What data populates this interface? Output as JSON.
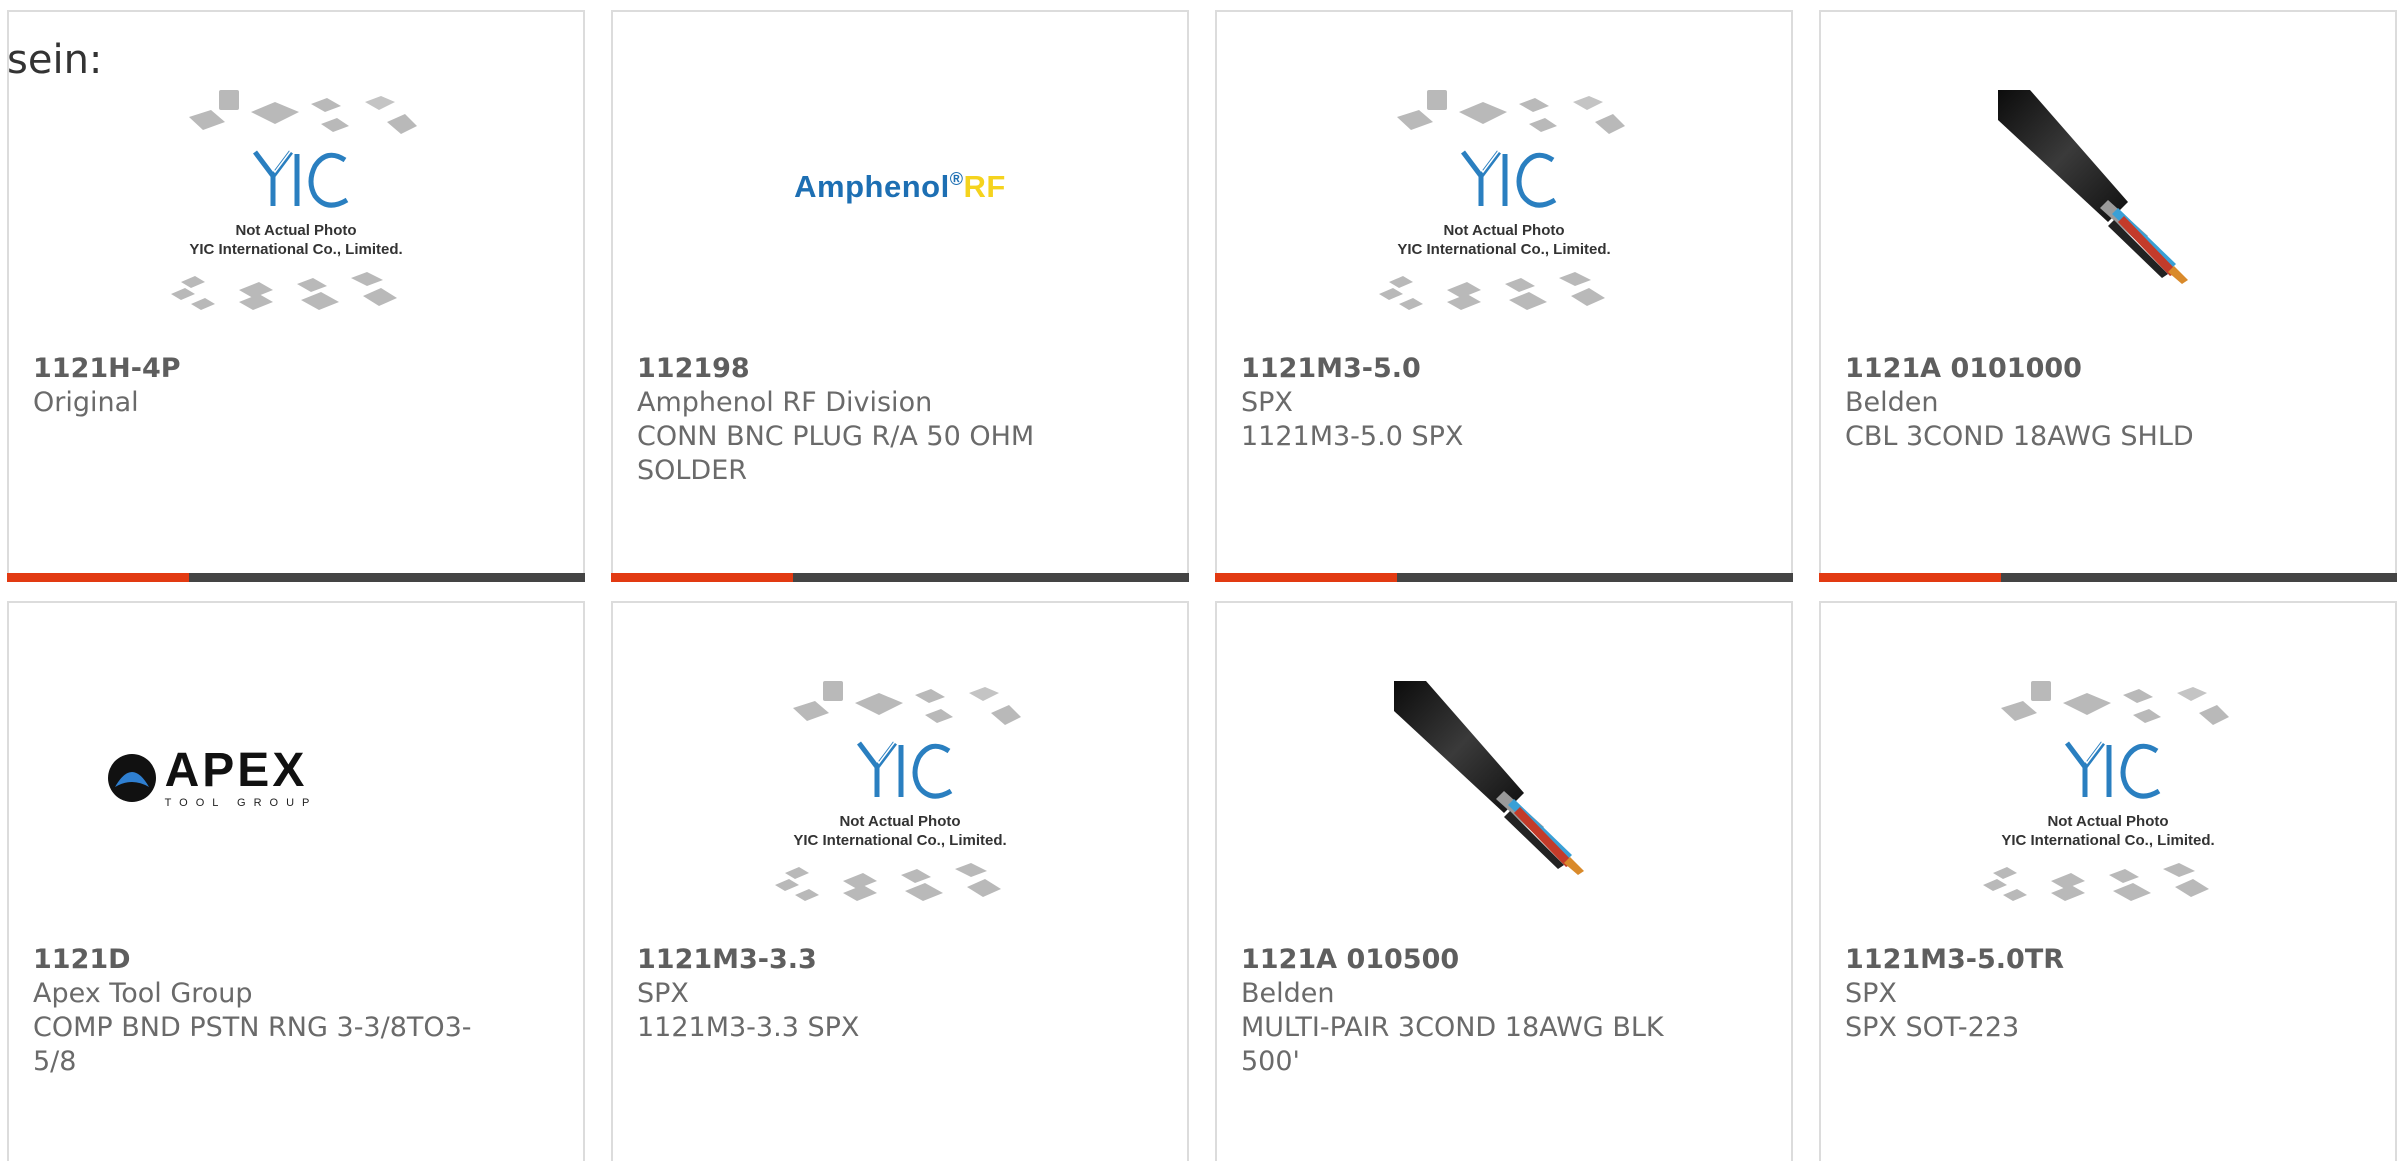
{
  "intro_text": "sein:",
  "colors": {
    "accent_orange": "#e23a12",
    "bar_dark": "#444444",
    "card_border": "#dcdcdc",
    "amphenol_blue": "#1d6fb3",
    "amphenol_yellow": "#f5d31e",
    "yic_blue": "#2a7fc0"
  },
  "placeholder": {
    "line1": "Not Actual Photo",
    "line2": "YIC International Co., Limited."
  },
  "brands": {
    "amphenol_main": "Amphenol",
    "amphenol_reg": "®",
    "amphenol_rf": "RF",
    "apex_main": "APEX",
    "apex_sub": "TOOL GROUP"
  },
  "products": [
    {
      "part_number": "1121H-4P",
      "manufacturer": "Original",
      "desc1": "",
      "desc2": "",
      "image": "yic-placeholder"
    },
    {
      "part_number": "112198",
      "manufacturer": "Amphenol RF Division",
      "desc1": "CONN BNC PLUG R/A 50 OHM",
      "desc2": "SOLDER",
      "image": "amphenol-rf-logo"
    },
    {
      "part_number": "1121M3-5.0",
      "manufacturer": "SPX",
      "desc1": "1121M3-5.0 SPX",
      "desc2": "",
      "image": "yic-placeholder"
    },
    {
      "part_number": "1121A 0101000",
      "manufacturer": "Belden",
      "desc1": "CBL 3COND 18AWG SHLD",
      "desc2": "",
      "image": "cable-photo"
    },
    {
      "part_number": "1121D",
      "manufacturer": "Apex Tool Group",
      "desc1": "COMP BND PSTN RNG 3-3/8TO3-",
      "desc2": "5/8",
      "image": "apex-logo"
    },
    {
      "part_number": "1121M3-3.3",
      "manufacturer": "SPX",
      "desc1": "1121M3-3.3 SPX",
      "desc2": "",
      "image": "yic-placeholder"
    },
    {
      "part_number": "1121A 010500",
      "manufacturer": "Belden",
      "desc1": "MULTI-PAIR 3COND 18AWG BLK",
      "desc2": "500'",
      "image": "cable-photo"
    },
    {
      "part_number": "1121M3-5.0TR",
      "manufacturer": "SPX",
      "desc1": "SPX SOT-223",
      "desc2": "",
      "image": "yic-placeholder"
    }
  ]
}
